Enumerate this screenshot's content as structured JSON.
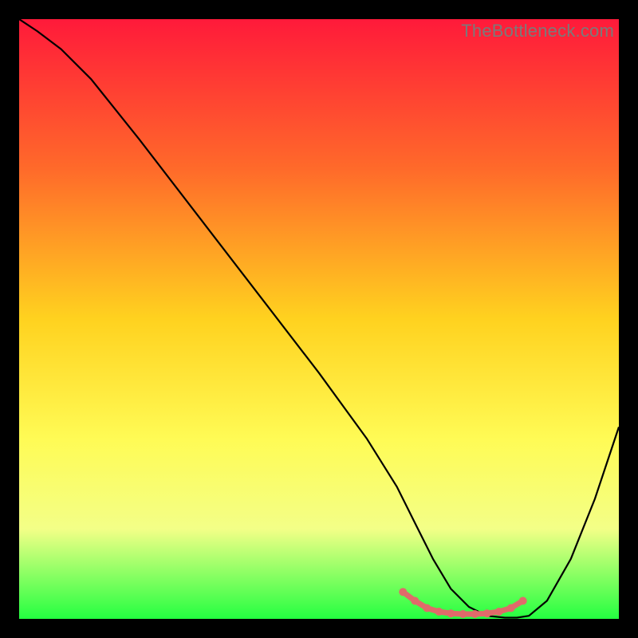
{
  "watermark": "TheBottleneck.com",
  "chart_data": {
    "type": "line",
    "title": "",
    "xlabel": "",
    "ylabel": "",
    "xlim": [
      0,
      100
    ],
    "ylim": [
      0,
      100
    ],
    "grid": false,
    "legend": false,
    "gradient_stops": [
      {
        "offset": 0,
        "color": "#ff1a3a"
      },
      {
        "offset": 25,
        "color": "#ff6a2a"
      },
      {
        "offset": 50,
        "color": "#ffd21f"
      },
      {
        "offset": 70,
        "color": "#fffb55"
      },
      {
        "offset": 85,
        "color": "#f3ff87"
      },
      {
        "offset": 100,
        "color": "#24ff41"
      }
    ],
    "series": [
      {
        "name": "bottleneck-curve",
        "color": "#000000",
        "x": [
          0,
          3,
          7,
          12,
          20,
          30,
          40,
          50,
          58,
          63,
          66,
          69,
          72,
          75,
          78,
          81,
          83,
          85,
          88,
          92,
          96,
          100
        ],
        "y": [
          100,
          98,
          95,
          90,
          80,
          67,
          54,
          41,
          30,
          22,
          16,
          10,
          5,
          2,
          0.5,
          0.2,
          0.2,
          0.5,
          3,
          10,
          20,
          32
        ]
      }
    ],
    "flat_region": {
      "name": "optimal-range-marker",
      "color": "#e06a6a",
      "x": [
        64,
        66,
        68,
        70,
        72,
        74,
        76,
        78,
        80,
        82,
        84
      ],
      "y": [
        4.5,
        3.0,
        1.8,
        1.2,
        0.9,
        0.8,
        0.8,
        0.9,
        1.2,
        1.8,
        3.0
      ]
    }
  }
}
